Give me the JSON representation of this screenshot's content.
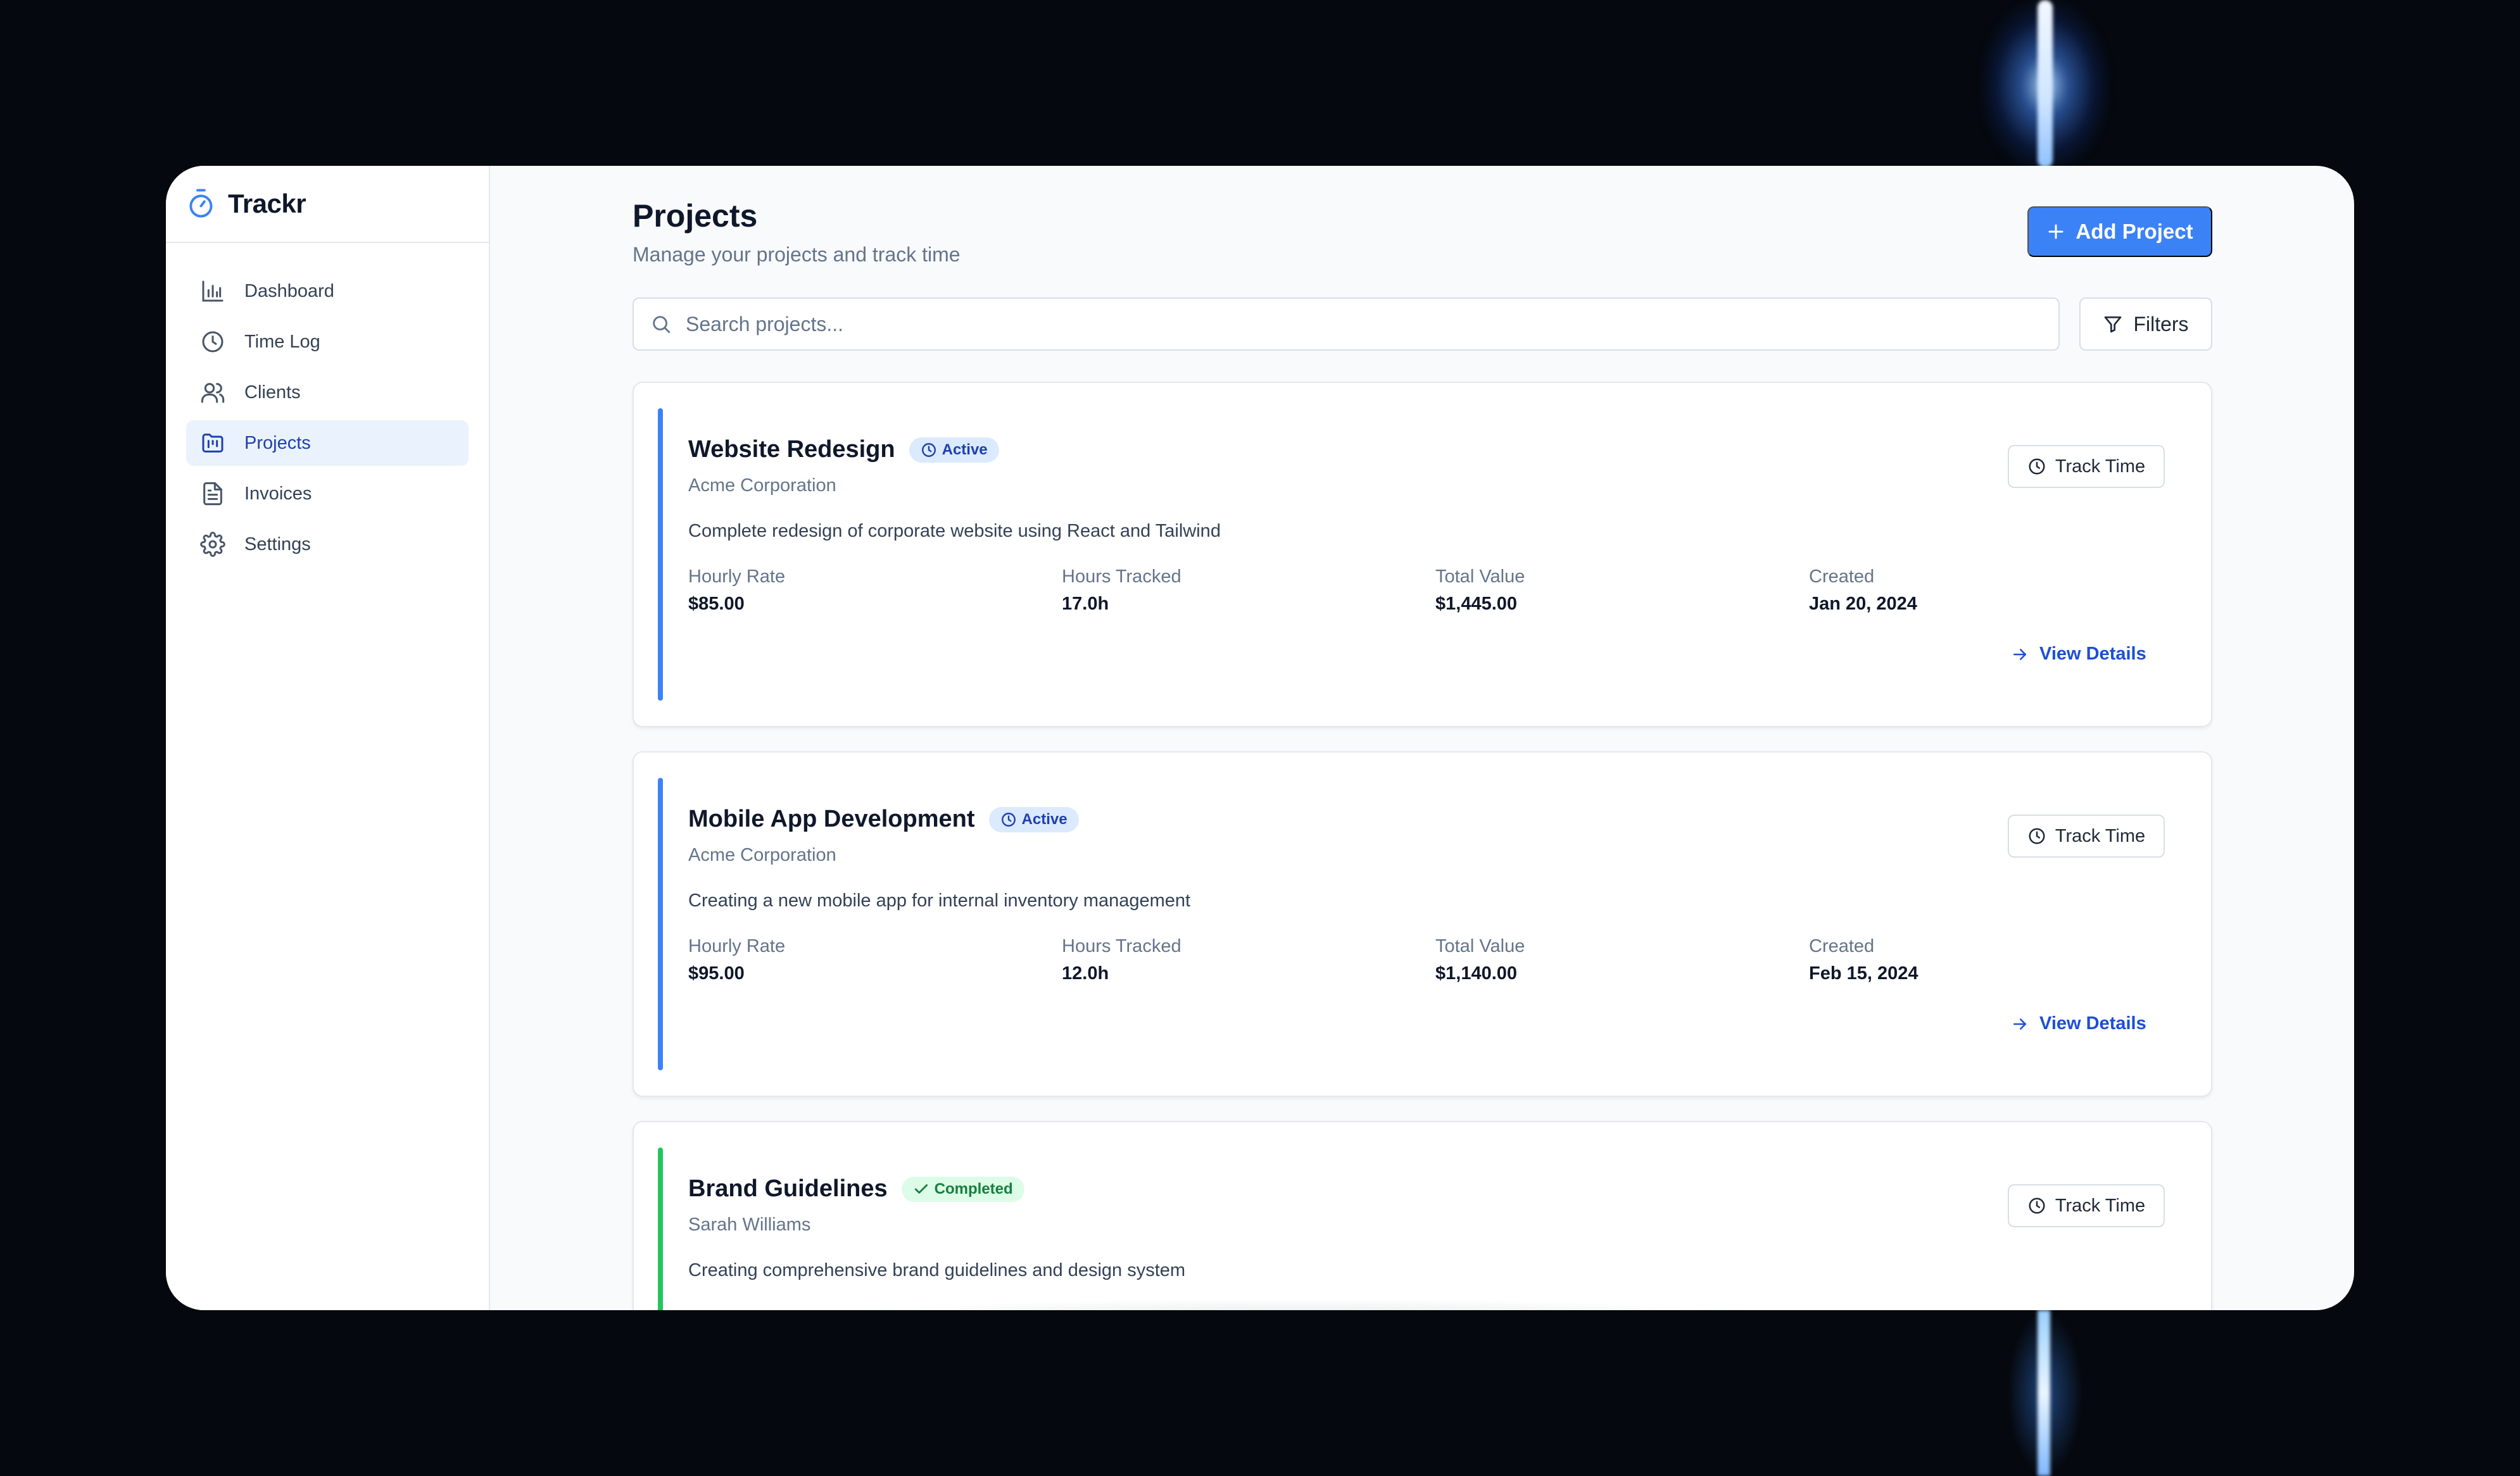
{
  "app": {
    "name": "Trackr"
  },
  "sidebar": {
    "items": [
      {
        "label": "Dashboard",
        "icon": "bar-chart-icon",
        "active": false
      },
      {
        "label": "Time Log",
        "icon": "clock-icon",
        "active": false
      },
      {
        "label": "Clients",
        "icon": "users-icon",
        "active": false
      },
      {
        "label": "Projects",
        "icon": "folder-kanban-icon",
        "active": true
      },
      {
        "label": "Invoices",
        "icon": "file-text-icon",
        "active": false
      },
      {
        "label": "Settings",
        "icon": "gear-icon",
        "active": false
      }
    ]
  },
  "header": {
    "title": "Projects",
    "subtitle": "Manage your projects and track time",
    "add_label": "Add Project"
  },
  "search": {
    "placeholder": "Search projects...",
    "value": ""
  },
  "filters": {
    "label": "Filters"
  },
  "labels": {
    "hourly_rate": "Hourly Rate",
    "hours_tracked": "Hours Tracked",
    "total_value": "Total Value",
    "created": "Created",
    "track_time": "Track Time",
    "view_details": "View Details"
  },
  "projects": [
    {
      "name": "Website Redesign",
      "status": "Active",
      "client": "Acme Corporation",
      "description": "Complete redesign of corporate website using React and Tailwind",
      "hourly_rate": "$85.00",
      "hours_tracked": "17.0h",
      "total_value": "$1,445.00",
      "created": "Jan 20, 2024",
      "accent": "#3b82f6"
    },
    {
      "name": "Mobile App Development",
      "status": "Active",
      "client": "Acme Corporation",
      "description": "Creating a new mobile app for internal inventory management",
      "hourly_rate": "$95.00",
      "hours_tracked": "12.0h",
      "total_value": "$1,140.00",
      "created": "Feb 15, 2024",
      "accent": "#3b82f6"
    },
    {
      "name": "Brand Guidelines",
      "status": "Completed",
      "client": "Sarah Williams",
      "description": "Creating comprehensive brand guidelines and design system",
      "accent": "#22c55e"
    }
  ],
  "colors": {
    "primary": "#3b82f6",
    "active_badge_bg": "#dbeafe",
    "completed_badge_bg": "#dcfce7",
    "completed_accent": "#22c55e"
  }
}
